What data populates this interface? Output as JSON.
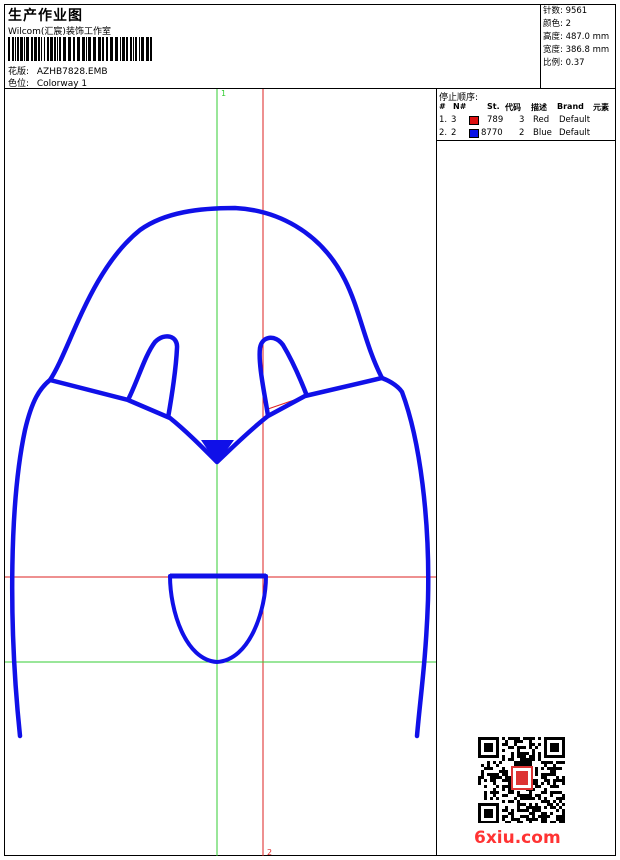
{
  "header": {
    "title": "生产作业图",
    "company": "Wilcom(汇宸)装饰工作室",
    "design_label": "花版:",
    "design_value": "AZHB7828.EMB",
    "colorway_label": "色位:",
    "colorway_value": "Colorway 1"
  },
  "stats": [
    {
      "label": "针数:",
      "value": "9561"
    },
    {
      "label": "颜色:",
      "value": "2"
    },
    {
      "label": "高度:",
      "value": "487.0 mm"
    },
    {
      "label": "宽度:",
      "value": "386.8 mm"
    },
    {
      "label": "比例:",
      "value": "0.37"
    }
  ],
  "stop_sequence": {
    "title": "停止顺序:",
    "columns": [
      "#",
      "N#",
      "St.",
      "代码",
      "描述",
      "Brand",
      "元素"
    ],
    "rows": [
      {
        "index": "1.",
        "n": "3",
        "color": "#dd1111",
        "stitches": "789",
        "code": "3",
        "desc": "Red",
        "brand": "Default"
      },
      {
        "index": "2.",
        "n": "2",
        "color": "#0a12e6",
        "stitches": "8770",
        "code": "2",
        "desc": "Blue",
        "brand": "Default"
      }
    ]
  },
  "guides": {
    "vertical_1": "1",
    "vertical_2": "2"
  },
  "colors": {
    "outline": "#1010e8",
    "guide_green": "#33cc33",
    "guide_red": "#dd2222",
    "watermark": "#ff3333"
  },
  "watermark": "6xiu.com"
}
